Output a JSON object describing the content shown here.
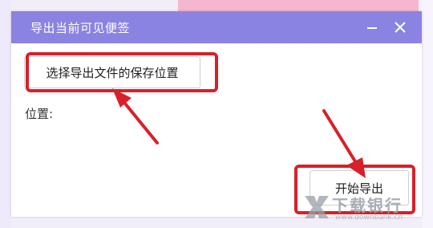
{
  "dialog": {
    "title": "导出当前可见便签",
    "choose_location_label": "选择导出文件的保存位置",
    "location_label": "位置:",
    "start_export_label": "开始导出"
  },
  "window_controls": {
    "minimize_icon": "minimize-icon",
    "close_icon": "close-icon"
  },
  "watermark": {
    "text": "下载银行",
    "url": "www.downbank.cn"
  },
  "colors": {
    "titlebar": "#8b83e2",
    "annotation": "#d8202a"
  }
}
